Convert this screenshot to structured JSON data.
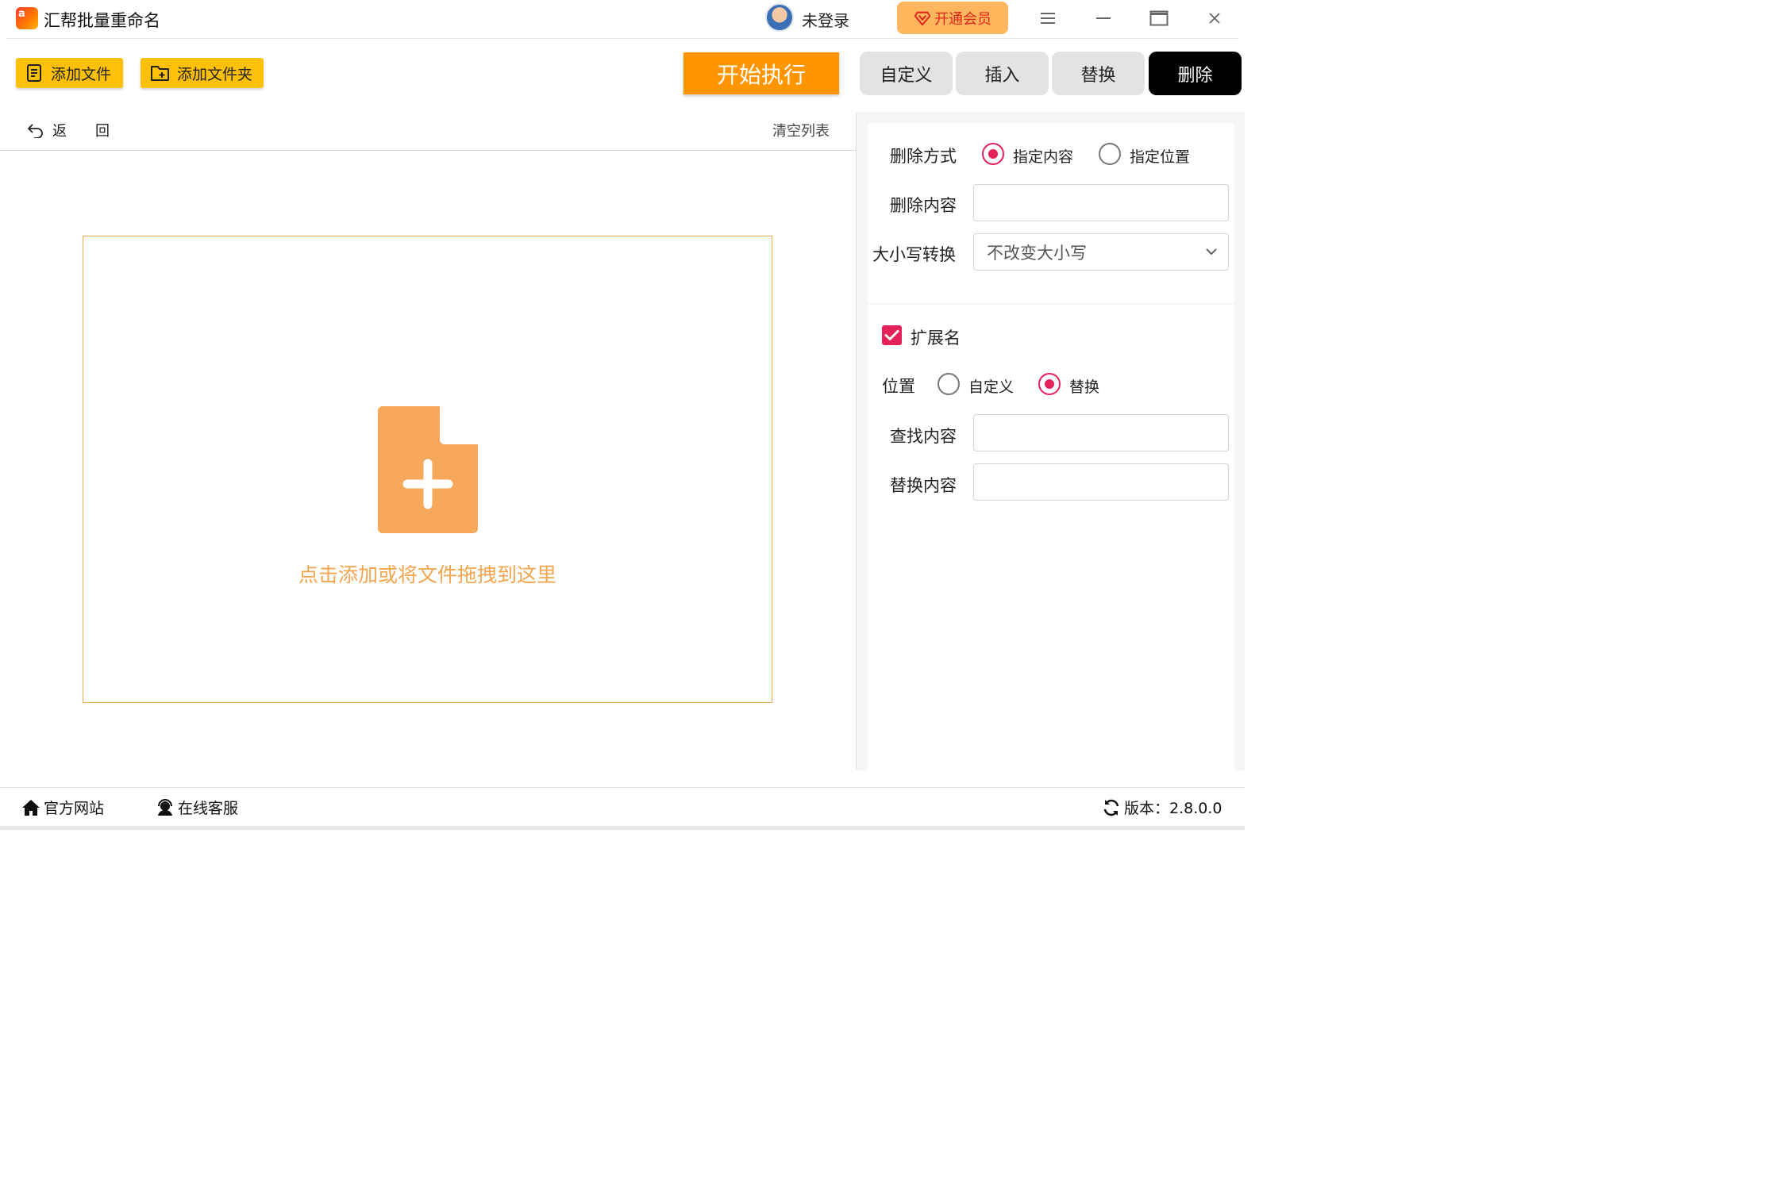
{
  "app": {
    "title": "汇帮批量重命名"
  },
  "user": {
    "login_text": "未登录",
    "vip_label": "开通会员"
  },
  "toolbar": {
    "add_file": "添加文件",
    "add_folder": "添加文件夹",
    "start": "开始执行"
  },
  "tabs": [
    {
      "label": "自定义",
      "active": false
    },
    {
      "label": "插入",
      "active": false
    },
    {
      "label": "替换",
      "active": false
    },
    {
      "label": "删除",
      "active": true
    }
  ],
  "list": {
    "back_chars": [
      "返",
      "回"
    ],
    "clear": "清空列表",
    "drop_hint": "点击添加或将文件拖拽到这里"
  },
  "delete_panel": {
    "method_label": "删除方式",
    "method_options": [
      {
        "label": "指定内容",
        "selected": true
      },
      {
        "label": "指定位置",
        "selected": false
      }
    ],
    "content_label": "删除内容",
    "content_value": "",
    "case_label": "大小写转换",
    "case_value": "不改变大小写"
  },
  "extension_panel": {
    "checkbox_label": "扩展名",
    "checked": true,
    "position_label": "位置",
    "position_options": [
      {
        "label": "自定义",
        "selected": false
      },
      {
        "label": "替换",
        "selected": true
      }
    ],
    "find_label": "查找内容",
    "find_value": "",
    "replace_label": "替换内容",
    "replace_value": ""
  },
  "footer": {
    "website": "官方网站",
    "support": "在线客服",
    "version": "版本：2.8.0.0"
  },
  "colors": {
    "accent": "#e5215a",
    "start": "#ff9500",
    "add_button": "#ffc107",
    "drop_border": "#f4a94e",
    "drop_icon": "#f7a85a",
    "vip_bg": "#ffb65c"
  }
}
